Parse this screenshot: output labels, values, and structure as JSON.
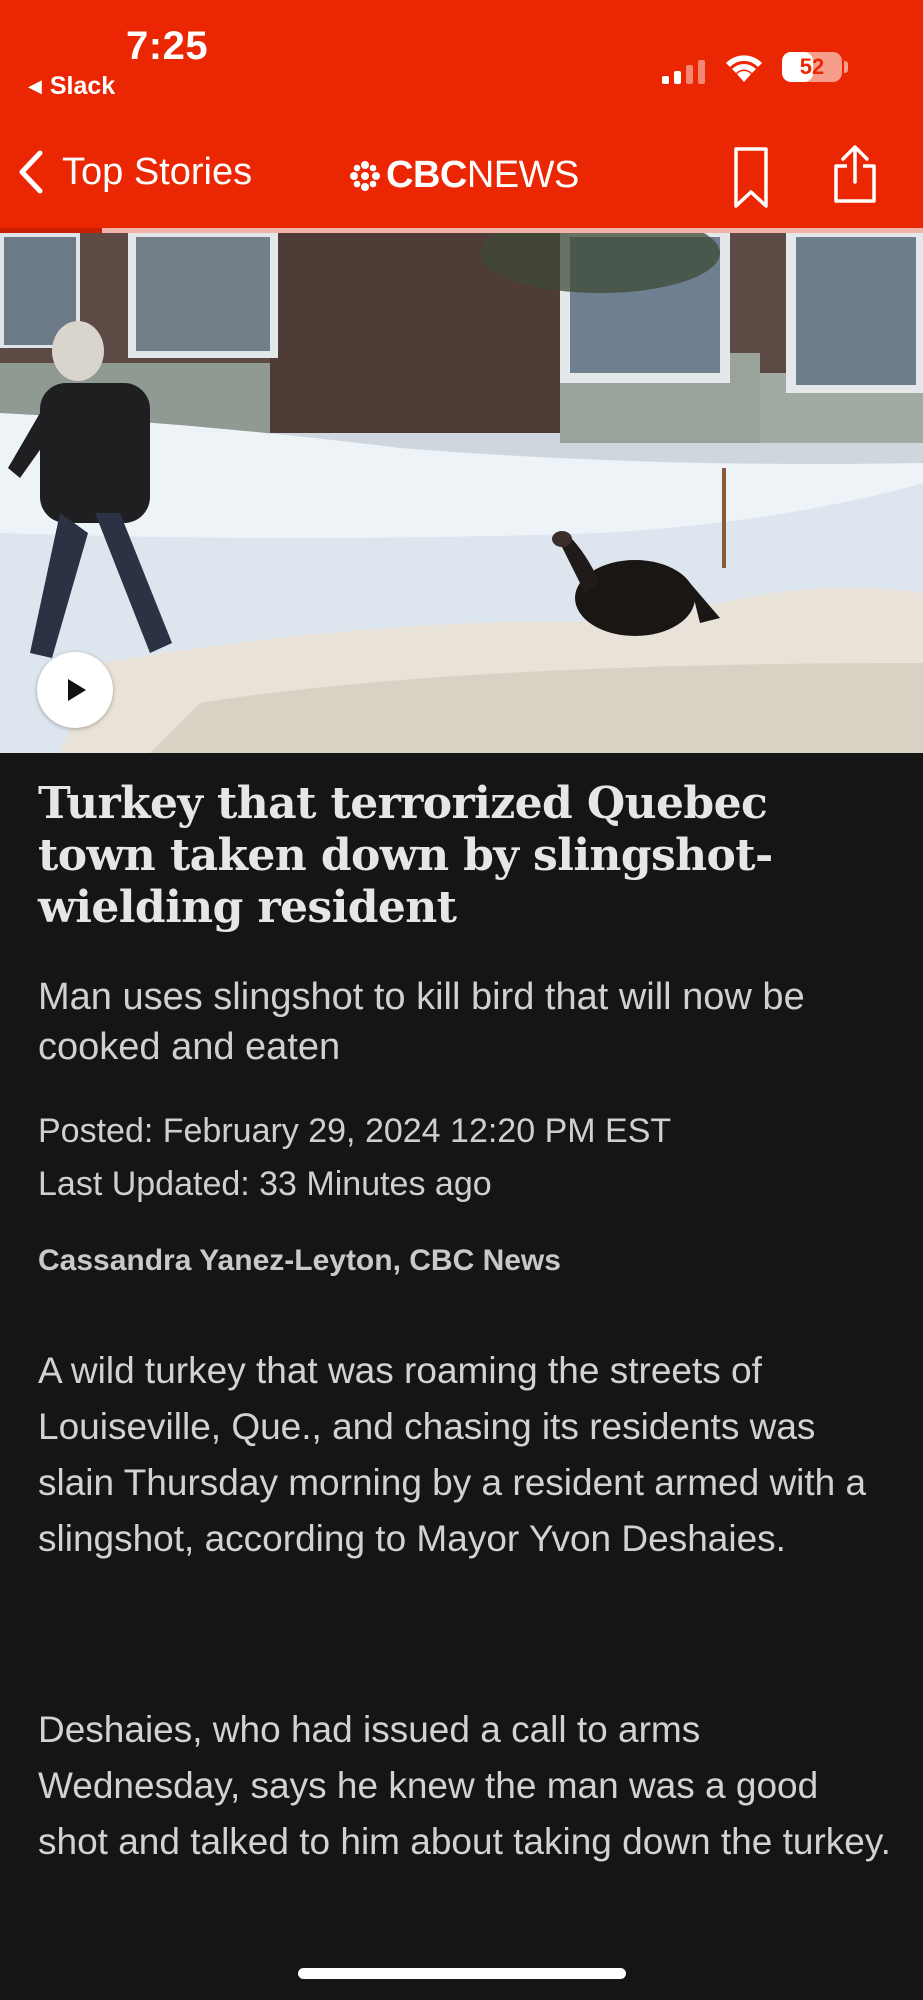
{
  "status_bar": {
    "time": "7:25",
    "back_app": "Slack",
    "battery_percent": "52",
    "battery_level": 0.52,
    "signal_bars": 2
  },
  "nav": {
    "back_label": "Top Stories",
    "logo_bold": "CBC",
    "logo_regular": "NEWS",
    "reading_progress": 0.11,
    "bookmark_icon": "bookmark-icon",
    "share_icon": "share-icon"
  },
  "colors": {
    "header_red": "#eb2602",
    "background": "#151515"
  },
  "hero": {
    "play_icon": "play-icon"
  },
  "article": {
    "headline": "Turkey that terrorized Quebec town taken down by slingshot-wielding resident",
    "dek": "Man uses slingshot to kill bird that will now be cooked and eaten",
    "posted": "Posted: February 29, 2024 12:20 PM EST",
    "updated": "Last Updated: 33 Minutes ago",
    "byline": "Cassandra Yanez-Leyton, CBC News",
    "paragraphs": [
      "A wild turkey that was roaming the streets of Louiseville, Que., and chasing its residents was slain Thursday morning by a resident armed with a slingshot, according to Mayor Yvon Deshaies.",
      "Deshaies, who had issued a call to arms Wednesday, says he knew the man was a good shot and talked to him about taking down the turkey."
    ]
  }
}
